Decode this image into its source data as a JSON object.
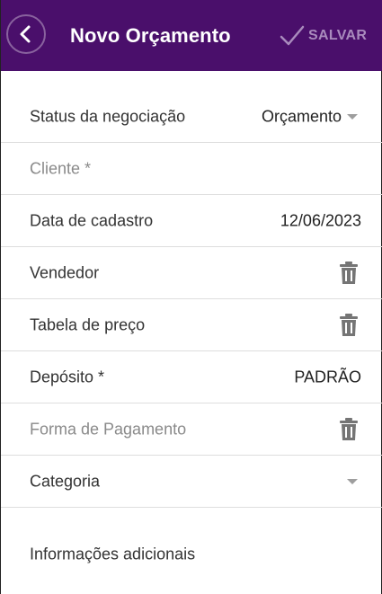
{
  "header": {
    "title": "Novo Orçamento",
    "save_label": "SALVAR",
    "back_icon": "chevron-left-icon",
    "check_icon": "check-icon",
    "bg_color": "#4a0f6b"
  },
  "form": {
    "status_label": "Status da negociação",
    "status_value": "Orçamento",
    "cliente_placeholder": "Cliente *",
    "data_label": "Data de cadastro",
    "data_value": "12/06/2023",
    "vendedor_label": "Vendedor",
    "tabela_label": "Tabela de preço",
    "deposito_label": "Depósito *",
    "deposito_value": "PADRÃO",
    "forma_label": "Forma de Pagamento",
    "categoria_label": "Categoria",
    "info_label": "Informações adicionais"
  }
}
